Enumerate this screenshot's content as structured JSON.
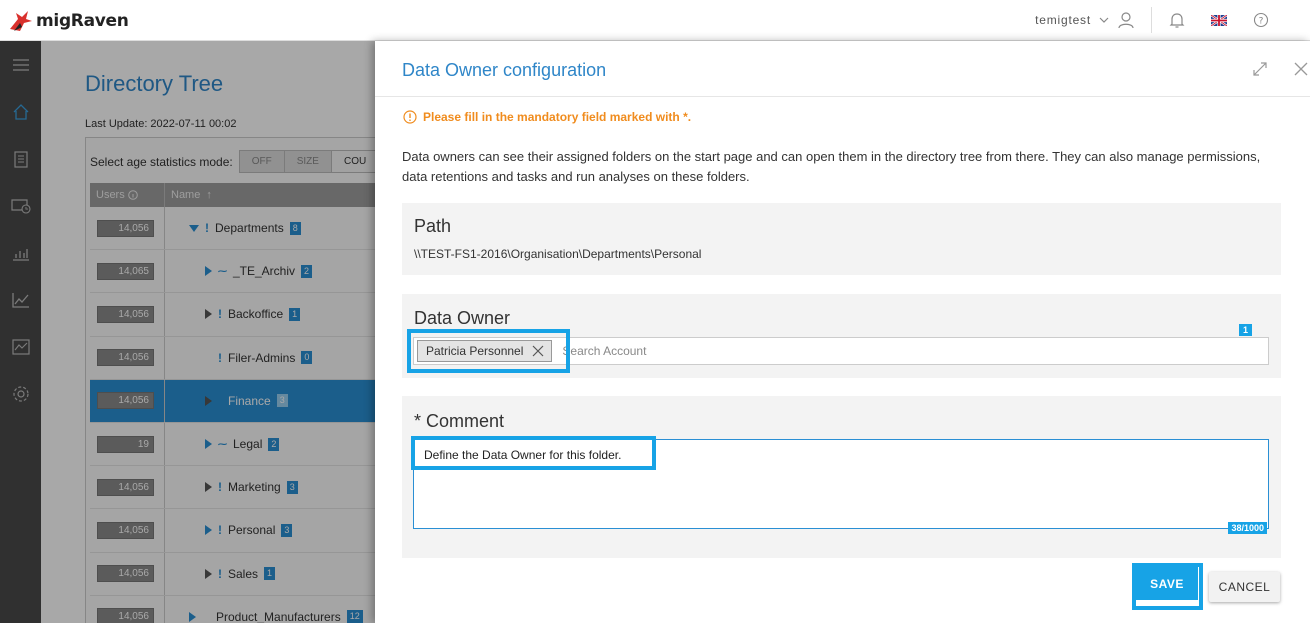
{
  "app": {
    "logo_text": "migRaven"
  },
  "topbar": {
    "username": "temigtest"
  },
  "background": {
    "title": "Directory Tree",
    "last_update": "Last Update: 2022-07-11 00:02",
    "age_mode_label": "Select age statistics mode:",
    "age_modes": [
      "OFF",
      "SIZE",
      "COU"
    ],
    "col_users": "Users",
    "col_name": "Name",
    "rows": [
      {
        "users": "14,056",
        "name": "Departments",
        "count": "8"
      },
      {
        "users": "14,065",
        "name": "_TE_Archiv",
        "count": "2"
      },
      {
        "users": "14,056",
        "name": "Backoffice",
        "count": "1"
      },
      {
        "users": "14,056",
        "name": "Filer-Admins",
        "count": "0"
      },
      {
        "users": "14,056",
        "name": "Finance",
        "count": "3"
      },
      {
        "users": "19",
        "name": "Legal",
        "count": "2"
      },
      {
        "users": "14,056",
        "name": "Marketing",
        "count": "3"
      },
      {
        "users": "14,056",
        "name": "Personal",
        "count": "3"
      },
      {
        "users": "14,056",
        "name": "Sales",
        "count": "1"
      },
      {
        "users": "14,056",
        "name": "Product_Manufacturers",
        "count": "12"
      }
    ]
  },
  "modal": {
    "title": "Data Owner configuration",
    "warning": "Please fill in the mandatory field marked with *.",
    "description": "Data owners can see their assigned folders on the start page and can open them in the directory tree from there. They can also manage permissions, data retentions and tasks and run analyses on these folders.",
    "path_label": "Path",
    "path_value": "\\\\TEST-FS1-2016\\Organisation\\Departments\\Personal",
    "owner_label": "Data Owner",
    "owner_count": "1",
    "owner_chip": "Patricia Personnel",
    "search_placeholder": "Search Account",
    "comment_label": "* Comment",
    "comment_value": "Define the Data Owner for this folder.",
    "char_count": "38/1000",
    "save_label": "SAVE",
    "cancel_label": "CANCEL"
  },
  "colors": {
    "accent": "#17a3e6",
    "title_blue": "#2f86c8",
    "warning": "#f08c1e",
    "sidebar": "#4a4a4a"
  }
}
